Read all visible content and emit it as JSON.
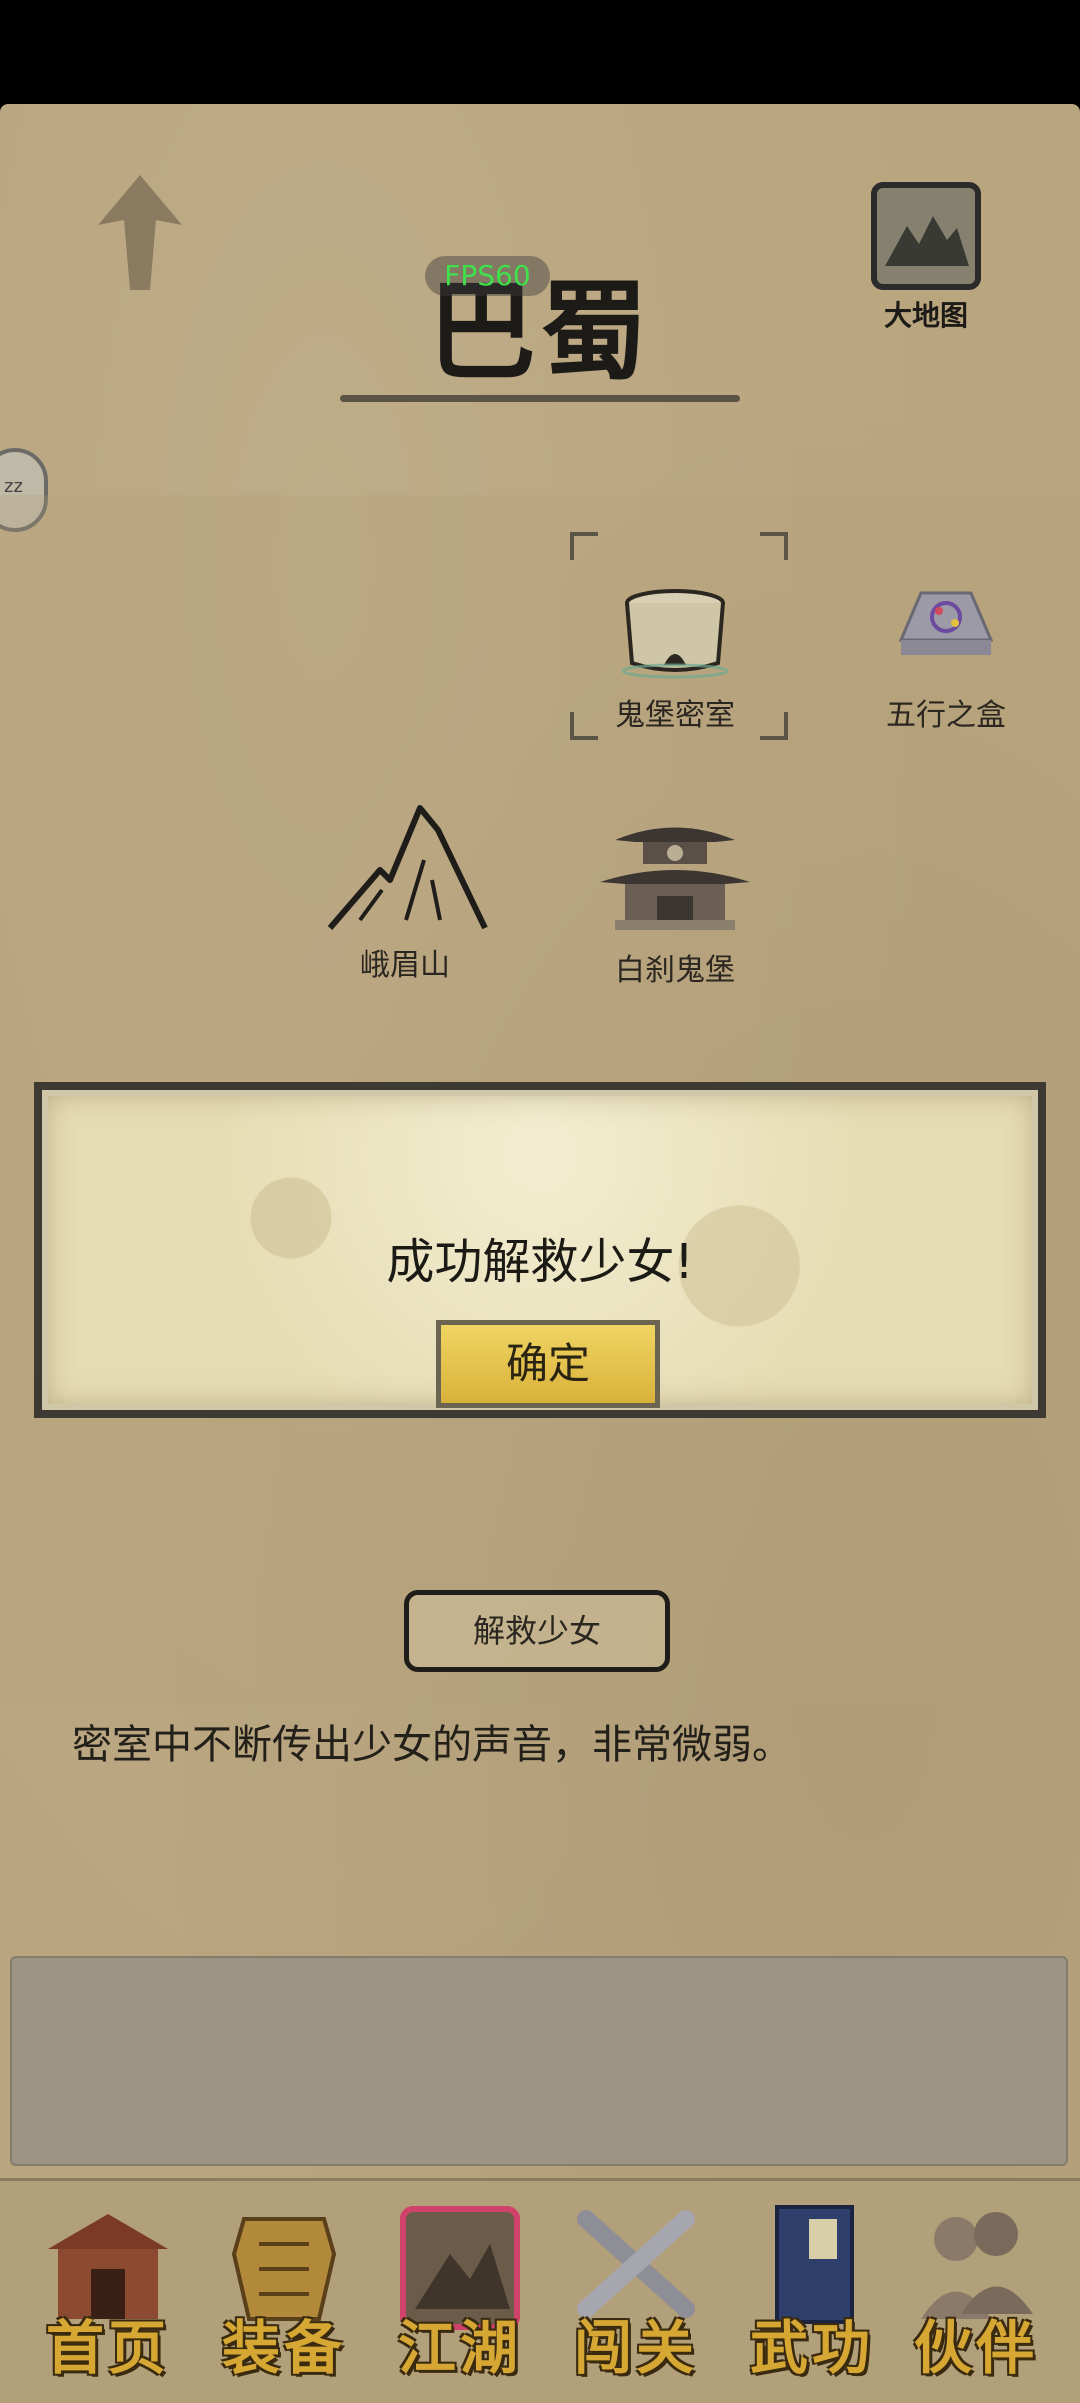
{
  "region": {
    "title": "巴蜀",
    "fps": "FPS60"
  },
  "world_map": {
    "label": "大地图"
  },
  "side_tab": {
    "text": "zz"
  },
  "locations": [
    {
      "name": "鬼堡密室",
      "icon": "chest-icon"
    },
    {
      "name": "五行之盒",
      "icon": "box-icon"
    },
    {
      "name": "峨眉山",
      "icon": "mountain-icon"
    },
    {
      "name": "白刹鬼堡",
      "icon": "pagoda-icon"
    }
  ],
  "dialog": {
    "message": "成功解救少女!",
    "ok_label": "确定"
  },
  "action": {
    "label": "解救少女"
  },
  "description": "密室中不断传出少女的声音，非常微弱。",
  "nav": [
    {
      "label": "首页",
      "icon": "house-icon"
    },
    {
      "label": "装备",
      "icon": "armor-icon"
    },
    {
      "label": "江湖",
      "icon": "scroll-map-icon"
    },
    {
      "label": "闯关",
      "icon": "swords-icon"
    },
    {
      "label": "武功",
      "icon": "book-icon"
    },
    {
      "label": "伙伴",
      "icon": "partners-icon"
    }
  ],
  "colors": {
    "accent_gold": "#d6a833",
    "button_yellow": "#e8c44d",
    "fps_green": "#3fe04a"
  }
}
